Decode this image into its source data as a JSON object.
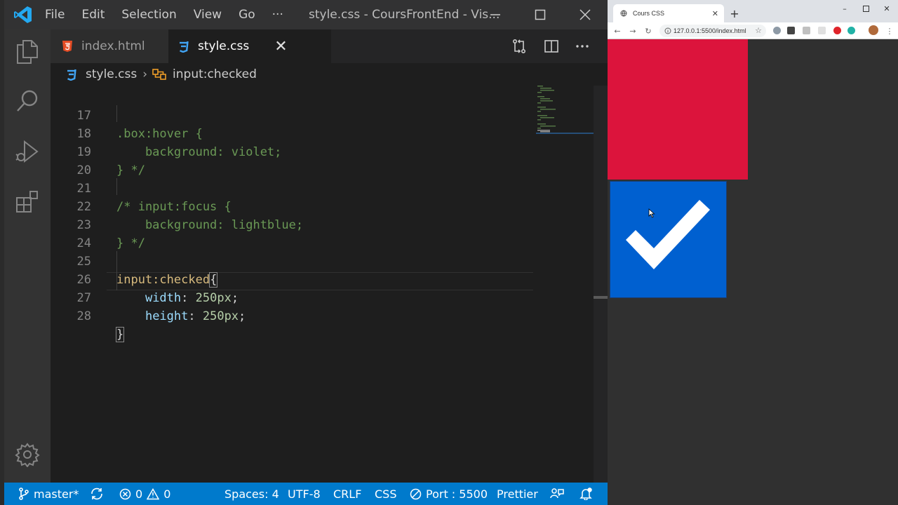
{
  "vscode": {
    "menu": [
      "File",
      "Edit",
      "Selection",
      "View",
      "Go",
      "···"
    ],
    "window_title": "style.css - CoursFrontEnd - Vis...",
    "tabs": [
      {
        "label": "index.html",
        "active": false
      },
      {
        "label": "style.css",
        "active": true
      }
    ],
    "breadcrumb": {
      "file": "style.css",
      "symbol": "input:checked"
    },
    "code_lines": [
      {
        "n": "17",
        "text": ".box:hover {"
      },
      {
        "n": "18",
        "text": "    background: violet;"
      },
      {
        "n": "19",
        "text": "} */"
      },
      {
        "n": "20",
        "text": ""
      },
      {
        "n": "21",
        "text": "/* input:focus {"
      },
      {
        "n": "22",
        "text": "    background: lightblue;"
      },
      {
        "n": "23",
        "text": "} */"
      },
      {
        "n": "24",
        "text": ""
      },
      {
        "n": "25",
        "selector": "input:checked",
        "brace": "{"
      },
      {
        "n": "26",
        "prop": "width",
        "value": "250px"
      },
      {
        "n": "27",
        "prop": "height",
        "value": "250px"
      },
      {
        "n": "28",
        "brace": "}"
      }
    ],
    "statusbar": {
      "branch": "master*",
      "errors": "0",
      "warnings": "0",
      "spaces": "Spaces: 4",
      "encoding": "UTF-8",
      "eol": "CRLF",
      "language": "CSS",
      "port": "Port : 5500",
      "formatter": "Prettier"
    },
    "colors": {
      "accent": "#007acc",
      "comment": "#6a9955",
      "selector": "#d7ba7d",
      "property": "#9cdcfe",
      "number": "#b5cea8"
    }
  },
  "browser": {
    "tab_title": "Cours CSS",
    "url": "127.0.0.1:5500/index.html",
    "page": {
      "box_color": "#dc143c",
      "checkbox_color": "#0060d0",
      "checkbox_checked": true
    }
  }
}
